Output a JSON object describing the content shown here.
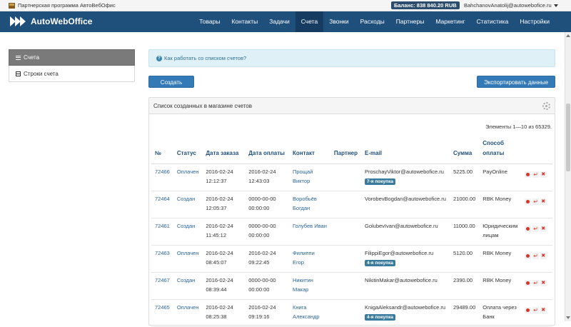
{
  "topbar": {
    "promo": "Партнерская программа АвтоВебОфис",
    "balance": "Баланс: 838 840.20 RUB",
    "user": "BahchanovAnatolij@autowebofice.ru"
  },
  "navbar": {
    "logo": "AutoWebOffice",
    "items": [
      "Товары",
      "Контакты",
      "Задачи",
      "Счета",
      "Звонки",
      "Расходы",
      "Партнеры",
      "Маркетинг",
      "Статистика",
      "Настройки"
    ],
    "active": "Счета"
  },
  "sidebar": {
    "items": [
      {
        "label": "Счета",
        "icon": "list-icon",
        "active": true
      },
      {
        "label": "Строки счета",
        "icon": "table-icon",
        "active": false
      }
    ]
  },
  "info": {
    "text": "Как работать со списком счетов?"
  },
  "buttons": {
    "create": "Создать",
    "export": "Экспортировать данные"
  },
  "panel": {
    "title": "Список созданных в магазине счетов",
    "counter": "Элементы 1—10 из 65329."
  },
  "table": {
    "headers": {
      "num": "№",
      "status": "Статус",
      "order_date": "Дата заказа",
      "pay_date": "Дата оплаты",
      "contact": "Контакт",
      "partner": "Партнер",
      "email": "E-mail",
      "sum": "Сумма",
      "method": "Способ оплаты"
    },
    "rows": [
      {
        "num": "72466",
        "status": "Оплачен",
        "order_date": "2016-02-24",
        "order_time": "12:12:37",
        "pay_date": "2016-02-24",
        "pay_time": "12:43:03",
        "contact1": "Прощай",
        "contact2": "Виктор",
        "partner": "",
        "email": "ProschayViktor@autowebofice.ru",
        "badge": "7-я покупка",
        "sum": "5225.00",
        "method1": "PayOnline",
        "method2": ""
      },
      {
        "num": "72464",
        "status": "Создан",
        "order_date": "2016-02-24",
        "order_time": "12:05:37",
        "pay_date": "0000-00-00",
        "pay_time": "00:00:00",
        "contact1": "Воробьёв",
        "contact2": "Богдан",
        "partner": "",
        "email": "VorobevBogdan@autowebofice.ru",
        "badge": "",
        "sum": "21000.00",
        "method1": "RBK Money",
        "method2": ""
      },
      {
        "num": "72461",
        "status": "Создан",
        "order_date": "2016-02-24",
        "order_time": "11:45:12",
        "pay_date": "0000-00-00",
        "pay_time": "00:00:00",
        "contact1": "Голубев Иван",
        "contact2": "",
        "partner": "",
        "email": "GolubevIvan@autowebofice.ru",
        "badge": "",
        "sum": "11000.00",
        "method1": "Юридическим",
        "method2": "лицам"
      },
      {
        "num": "72463",
        "status": "Оплачен",
        "order_date": "2016-02-24",
        "order_time": "08:45:07",
        "pay_date": "2016-02-24",
        "pay_time": "09:22:45",
        "contact1": "Филиппи Егор",
        "contact2": "",
        "partner": "",
        "email": "FilippiEgor@autowebofice.ru",
        "badge": "4-я покупка",
        "sum": "5120.00",
        "method1": "RBK Money",
        "method2": ""
      },
      {
        "num": "72467",
        "status": "Создан",
        "order_date": "2016-02-24",
        "order_time": "08:39:44",
        "pay_date": "0000-00-00",
        "pay_time": "00:00:00",
        "contact1": "Никитин",
        "contact2": "Макар",
        "partner": "",
        "email": "NikitinMakar@autowebofice.ru",
        "badge": "",
        "sum": "2390.00",
        "method1": "RBK Money",
        "method2": ""
      },
      {
        "num": "72465",
        "status": "Оплачен",
        "order_date": "2016-02-24",
        "order_time": "08:25:38",
        "pay_date": "2016-02-24",
        "pay_time": "09:19:16",
        "contact1": "Книга",
        "contact2": "Александр",
        "partner": "",
        "email": "KnigaAleksandr@autowebofice.ru",
        "badge": "4-я покупка",
        "sum": "29489.00",
        "method1": "Оплата через",
        "method2": "Банк"
      }
    ]
  },
  "colors": {
    "navbar": "#1f4f7b",
    "primary": "#337ab7",
    "badge": "#3a7a9c",
    "danger": "#d9342b"
  }
}
